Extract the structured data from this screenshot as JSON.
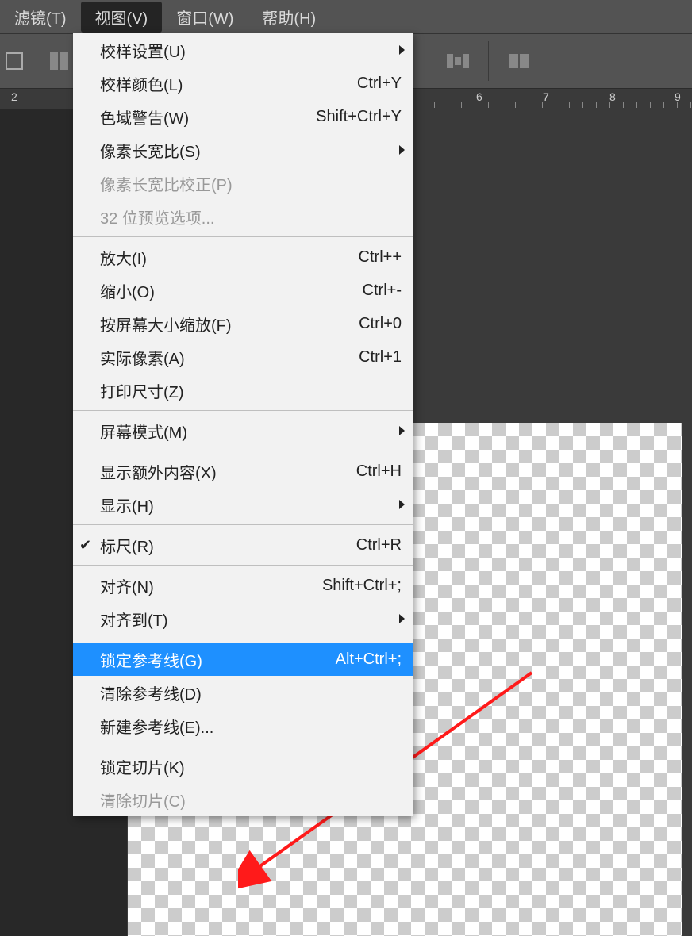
{
  "menubar": {
    "items": [
      {
        "label": "滤镜(T)"
      },
      {
        "label": "视图(V)",
        "active": true
      },
      {
        "label": "窗口(W)"
      },
      {
        "label": "帮助(H)"
      }
    ]
  },
  "ruler_ticks": [
    "2",
    "6",
    "7",
    "8",
    "9"
  ],
  "dropdown": {
    "groups": [
      [
        {
          "label": "校样设置(U)",
          "shortcut": "",
          "submenu": true
        },
        {
          "label": "校样颜色(L)",
          "shortcut": "Ctrl+Y"
        },
        {
          "label": "色域警告(W)",
          "shortcut": "Shift+Ctrl+Y"
        },
        {
          "label": "像素长宽比(S)",
          "shortcut": "",
          "submenu": true
        },
        {
          "label": "像素长宽比校正(P)",
          "shortcut": "",
          "disabled": true
        },
        {
          "label": "32 位预览选项...",
          "shortcut": "",
          "disabled": true
        }
      ],
      [
        {
          "label": "放大(I)",
          "shortcut": "Ctrl++"
        },
        {
          "label": "缩小(O)",
          "shortcut": "Ctrl+-"
        },
        {
          "label": "按屏幕大小缩放(F)",
          "shortcut": "Ctrl+0"
        },
        {
          "label": "实际像素(A)",
          "shortcut": "Ctrl+1"
        },
        {
          "label": "打印尺寸(Z)",
          "shortcut": ""
        }
      ],
      [
        {
          "label": "屏幕模式(M)",
          "shortcut": "",
          "submenu": true
        }
      ],
      [
        {
          "label": "显示额外内容(X)",
          "shortcut": "Ctrl+H"
        },
        {
          "label": "显示(H)",
          "shortcut": "",
          "submenu": true
        }
      ],
      [
        {
          "label": "标尺(R)",
          "shortcut": "Ctrl+R",
          "checked": true
        }
      ],
      [
        {
          "label": "对齐(N)",
          "shortcut": "Shift+Ctrl+;"
        },
        {
          "label": "对齐到(T)",
          "shortcut": "",
          "submenu": true
        }
      ],
      [
        {
          "label": "锁定参考线(G)",
          "shortcut": "Alt+Ctrl+;",
          "highlight": true
        },
        {
          "label": "清除参考线(D)",
          "shortcut": ""
        },
        {
          "label": "新建参考线(E)...",
          "shortcut": ""
        }
      ],
      [
        {
          "label": "锁定切片(K)",
          "shortcut": ""
        },
        {
          "label": "清除切片(C)",
          "shortcut": "",
          "disabled": true
        }
      ]
    ]
  }
}
